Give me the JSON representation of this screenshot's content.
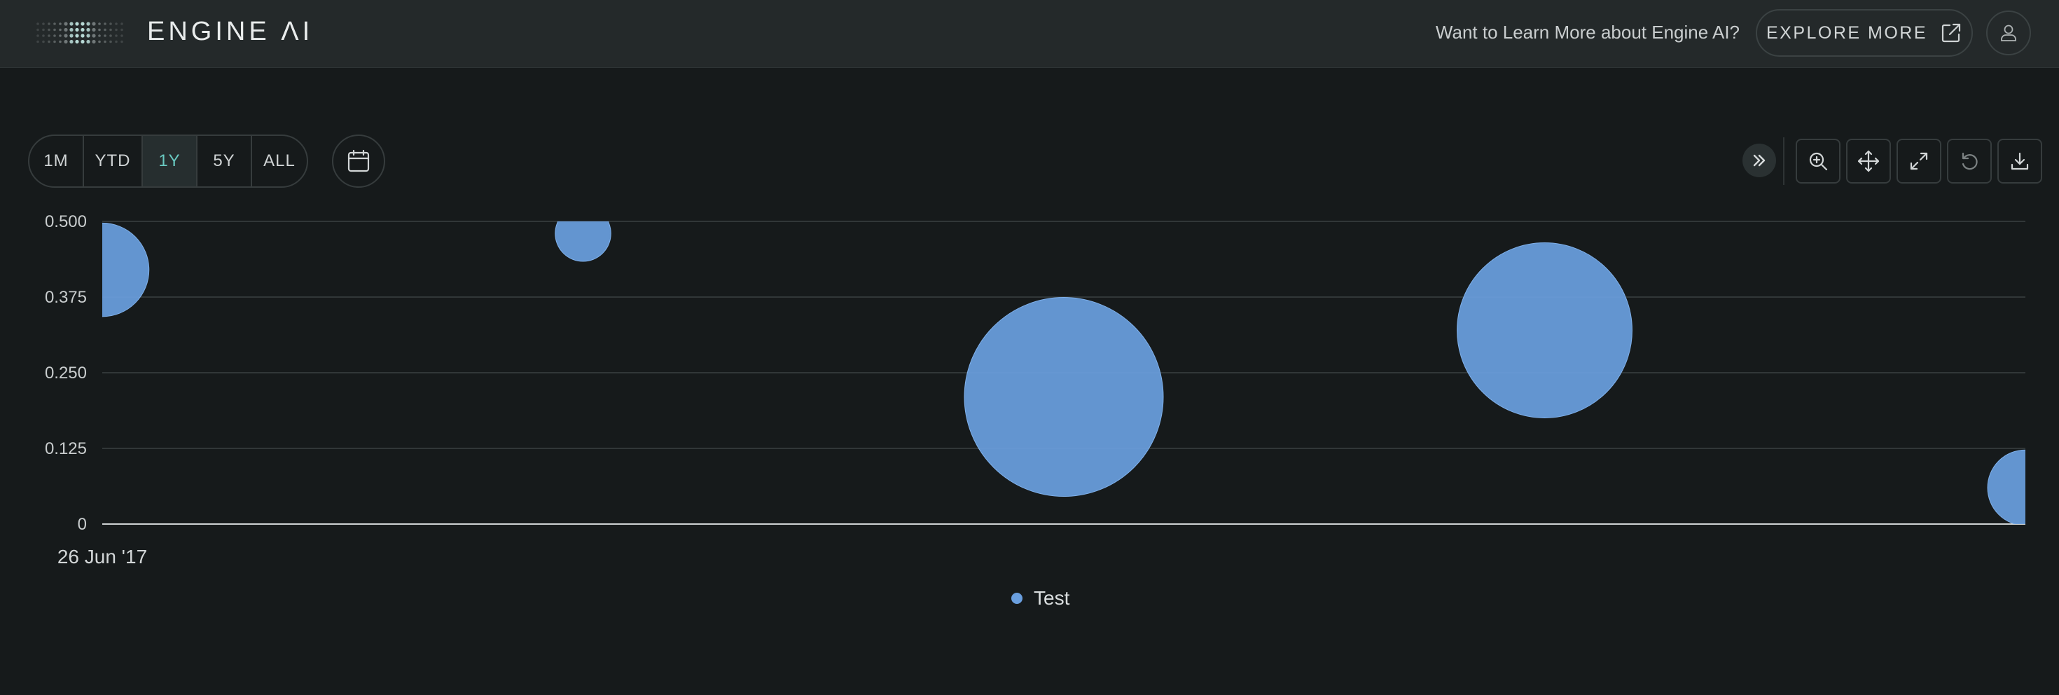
{
  "header": {
    "logo_text": "ENGINE ΛI",
    "learn_more": "Want to Learn More about Engine AI?",
    "explore_label": "EXPLORE MORE"
  },
  "controls": {
    "ranges": [
      "1M",
      "YTD",
      "1Y",
      "5Y",
      "ALL"
    ],
    "active_range": "1Y"
  },
  "colors": {
    "bubble": "#6a9fdf",
    "accent": "#69c9c1",
    "background": "#161a1b",
    "header_bg": "#24292a"
  },
  "chart_data": {
    "type": "scatter",
    "subtype": "bubble",
    "ylim": [
      0,
      0.5
    ],
    "y_ticks": [
      "0.500",
      "0.375",
      "0.250",
      "0.125",
      "0"
    ],
    "x_tick_labels": [
      "26 Jun '17"
    ],
    "grid": true,
    "legend_position": "bottom-center",
    "series": [
      {
        "name": "Test",
        "color": "#6a9fdf",
        "points": [
          {
            "x": 0.0,
            "y": 0.42,
            "size": 0.47
          },
          {
            "x": 0.25,
            "y": 0.48,
            "size": 0.28
          },
          {
            "x": 0.5,
            "y": 0.21,
            "size": 1.0
          },
          {
            "x": 0.75,
            "y": 0.32,
            "size": 0.88
          },
          {
            "x": 1.0,
            "y": 0.06,
            "size": 0.38
          }
        ]
      }
    ]
  }
}
